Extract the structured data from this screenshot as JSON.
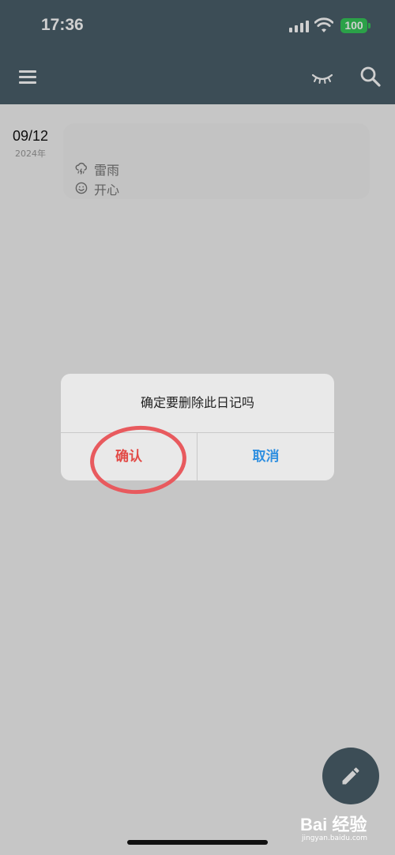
{
  "status_bar": {
    "time": "17:36",
    "battery": "100",
    "icons": [
      "signal-icon",
      "wifi-icon",
      "battery-icon"
    ]
  },
  "app_bar": {
    "icons": [
      "menu-icon",
      "eye-closed-icon",
      "search-icon"
    ]
  },
  "entries": [
    {
      "date": "09/12",
      "year": "2024年",
      "weather": "雷雨",
      "weather_icon": "thunderstorm-icon",
      "mood": "开心",
      "mood_icon": "smile-icon"
    }
  ],
  "dialog": {
    "message": "确定要删除此日记吗",
    "confirm_label": "确认",
    "cancel_label": "取消"
  },
  "fab": {
    "icon": "pencil-icon"
  },
  "watermark": {
    "logo": "Bai 经验",
    "url": "jingyan.baidu.com"
  },
  "colors": {
    "app_bar": "#4b5f6a",
    "confirm": "#e24b47",
    "cancel": "#2f8fe0",
    "battery": "#35c759",
    "annotation": "#e85a5e"
  }
}
